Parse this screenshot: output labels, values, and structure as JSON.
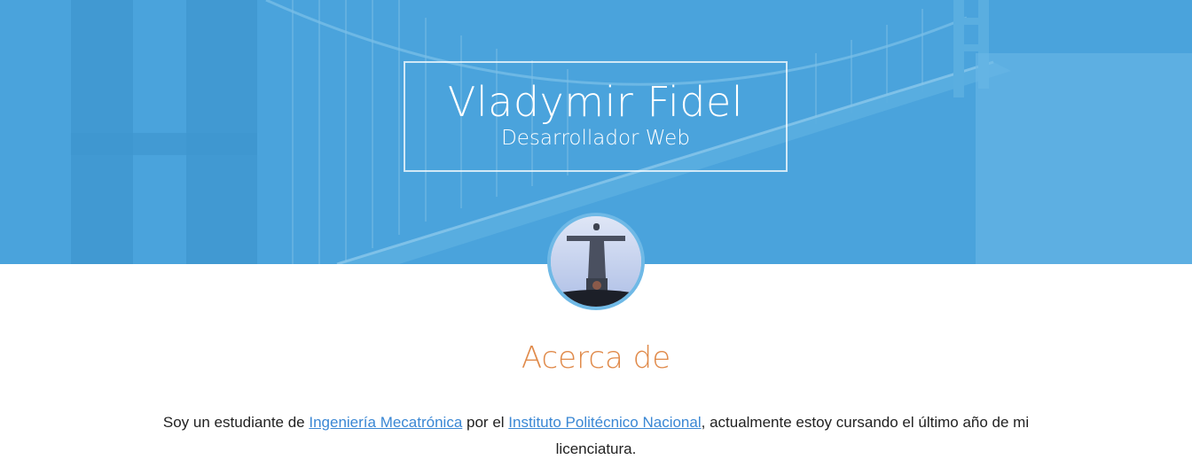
{
  "hero": {
    "name": "Vladymir Fidel",
    "role": "Desarrollador Web"
  },
  "about": {
    "title": "Acerca de",
    "text_before": "Soy un estudiante de ",
    "link_1": "Ingeniería Mecatrónica",
    "text_middle": " por el ",
    "link_2": "Instituto Politécnico Nacional",
    "text_after": ", actualmente estoy cursando el último año de mi licenciatura."
  },
  "colors": {
    "hero_blue": "#4aa3dc",
    "accent_orange": "#e08a4a",
    "link_blue": "#3a87d4"
  },
  "icons": {
    "avatar": "profile-photo"
  }
}
